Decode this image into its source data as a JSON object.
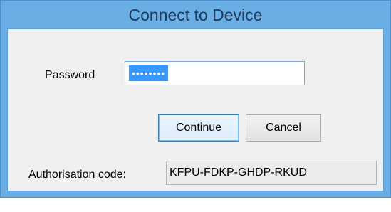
{
  "window": {
    "title": "Connect to Device"
  },
  "password": {
    "label": "Password",
    "masked_value": "••••••••"
  },
  "buttons": {
    "continue_label": "Continue",
    "cancel_label": "Cancel"
  },
  "authorisation": {
    "label": "Authorisation code:",
    "value": "KFPU-FDKP-GHDP-RKUD"
  },
  "colors": {
    "frame": "#6aaee6",
    "client_background": "#f0f0f0",
    "selection": "#3399ff",
    "default_button_border": "#3c7fb1"
  }
}
